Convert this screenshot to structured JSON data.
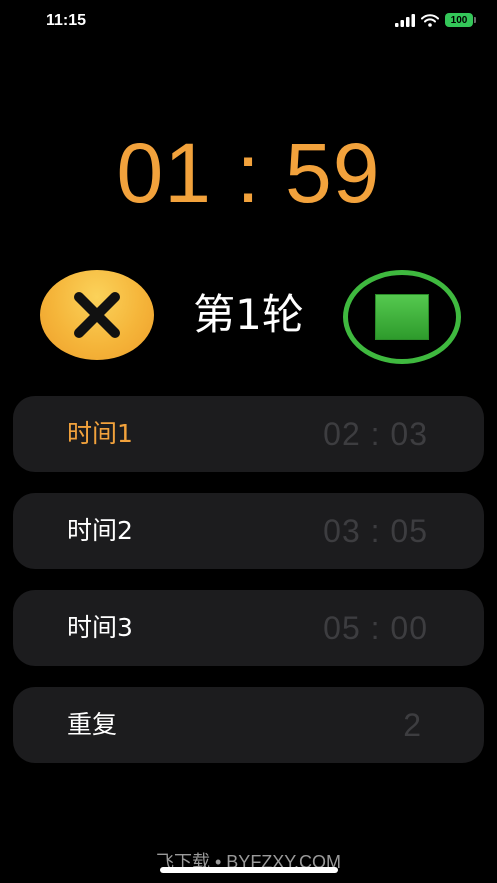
{
  "status_bar": {
    "time": "11:15",
    "battery": "100",
    "icons": [
      "signal-icon",
      "wifi-icon",
      "battery-icon"
    ]
  },
  "timer": {
    "display": "01 : 59"
  },
  "controls": {
    "round_label": "第1轮",
    "cancel_icon": "close-icon",
    "stop_icon": "stop-icon"
  },
  "settings": {
    "rows": [
      {
        "label": "时间1",
        "value": "02 : 03"
      },
      {
        "label": "时间2",
        "value": "03 : 05"
      },
      {
        "label": "时间3",
        "value": "05 : 00"
      },
      {
        "label": "重复",
        "value": "2"
      }
    ]
  },
  "watermark": "飞下载 • BYFZXY.COM",
  "colors": {
    "accent": "#f2a23c",
    "stop_green": "#3fb93f",
    "row_background": "#1c1c1e",
    "value_gray": "#3d3d40",
    "battery_green": "#34c759"
  }
}
